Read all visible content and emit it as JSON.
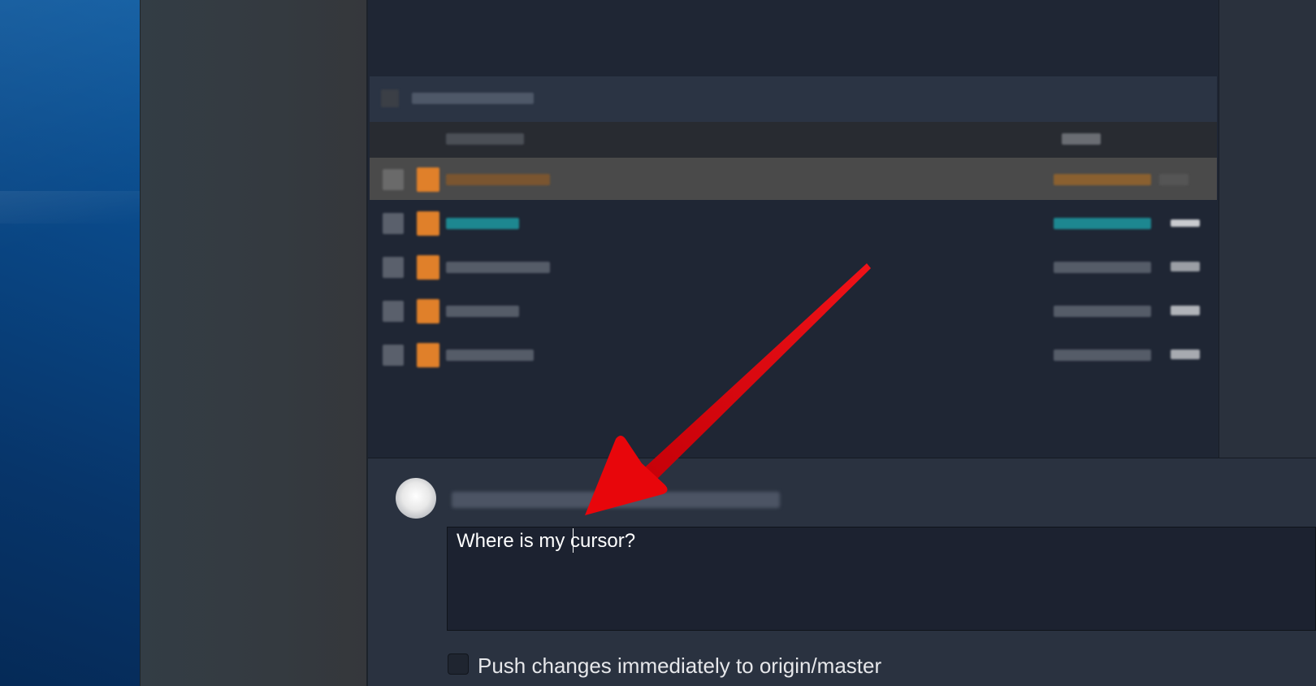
{
  "commit": {
    "message_value": "Where is my cursor?",
    "push_checkbox_label": "Push changes immediately to origin/master"
  },
  "annotation": {
    "arrow_color": "#e8060b",
    "arrow_icon": "arrow-pointer-icon"
  },
  "colors": {
    "desktop_blue": "#0b3a6f",
    "main_bg": "#1f2634",
    "commit_bg": "#2a3240",
    "file_icon_orange": "#e0802a",
    "teal_status": "#1d8790"
  }
}
